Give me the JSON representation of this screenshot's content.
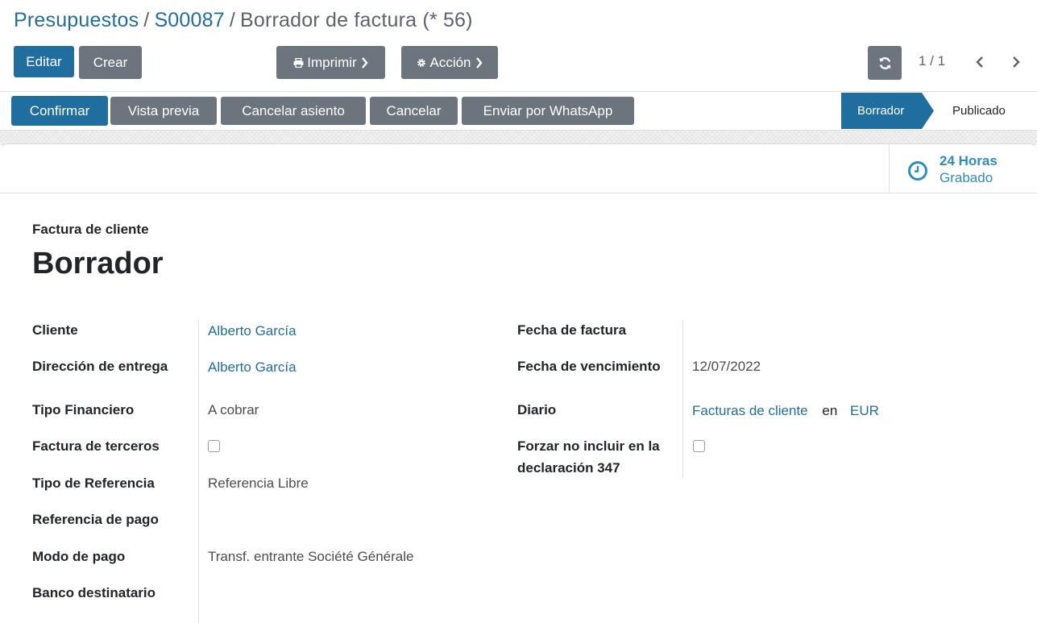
{
  "breadcrumb": {
    "item1": "Presupuestos",
    "sep": "/",
    "item2": "S00087",
    "current": "Borrador de factura (* 56)"
  },
  "toolbar": {
    "edit": "Editar",
    "create": "Crear",
    "print": "Imprimir",
    "action": "Acción",
    "pager": "1 / 1"
  },
  "header_buttons": {
    "confirm": "Confirmar",
    "preview": "Vista previa",
    "cancel_entry": "Cancelar asiento",
    "cancel": "Cancelar",
    "whatsapp": "Enviar por WhatsApp"
  },
  "statusbar": {
    "current": "Borrador",
    "next": "Publicado"
  },
  "stat_button": {
    "value": "24 Horas",
    "text": "Grabado"
  },
  "invoice": {
    "move_type": "Factura de cliente",
    "state": "Borrador"
  },
  "fields_left": {
    "cliente_label": "Cliente",
    "cliente_value": "Alberto García",
    "direccion_label": "Dirección de entrega",
    "direccion_value": "Alberto García",
    "tipo_fin_label": "Tipo Financiero",
    "tipo_fin_value": "A cobrar",
    "terceros_label": "Factura de terceros",
    "terceros_checked": false,
    "tipo_ref_label": "Tipo de Referencia",
    "tipo_ref_value": "Referencia Libre",
    "ref_pago_label": "Referencia de pago",
    "ref_pago_value": "",
    "modo_pago_label": "Modo de pago",
    "modo_pago_value": "Transf. entrante Société Générale",
    "banco_label": "Banco destinatario",
    "banco_value": ""
  },
  "fields_right": {
    "fecha_factura_label": "Fecha de factura",
    "fecha_factura_value": "",
    "vencimiento_label": "Fecha de vencimiento",
    "vencimiento_value": "12/07/2022",
    "diario_label": "Diario",
    "diario_value": "Facturas de cliente",
    "diario_en": "en",
    "diario_currency": "EUR",
    "forzar_label": "Forzar no incluir en la declaración 347",
    "forzar_checked": false
  },
  "colors": {
    "primary": "#1f6e9f",
    "secondary": "#6c757d",
    "link": "#1f6e9f",
    "stat": "#2f8bc4"
  }
}
